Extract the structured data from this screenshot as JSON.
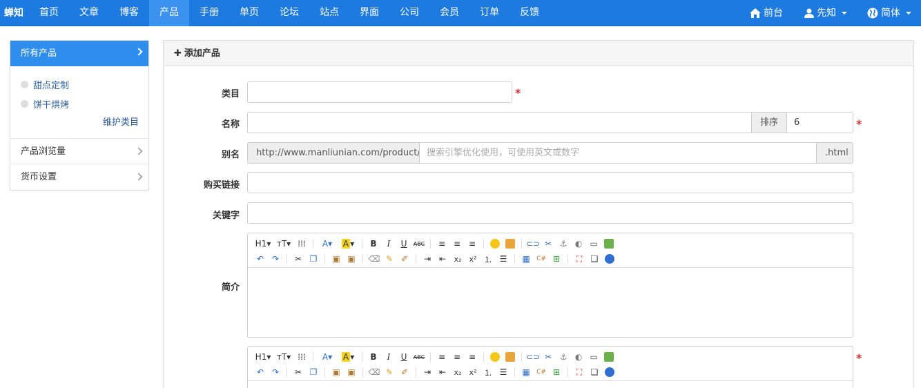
{
  "brand": "蝉知",
  "nav": {
    "items": [
      "首页",
      "文章",
      "博客",
      "产品",
      "手册",
      "单页",
      "论坛",
      "站点",
      "界面",
      "公司",
      "会员",
      "订单",
      "反馈"
    ],
    "active_index": 3,
    "frontend": "前台",
    "user": "先知",
    "lang": "简体"
  },
  "sidebar": {
    "header": "所有产品",
    "categories": [
      "甜点定制",
      "饼干烘烤"
    ],
    "maintain": "维护类目",
    "items": [
      "产品浏览量",
      "货币设置"
    ]
  },
  "form": {
    "title": "添加产品",
    "category_label": "类目",
    "name_label": "名称",
    "order_label": "排序",
    "order_value": "6",
    "alias_label": "别名",
    "alias_prefix": "http://www.manliunian.com/product/id_",
    "alias_placeholder": "搜索引擎优化使用，可使用英文或数字",
    "alias_suffix": ".html",
    "buy_link_label": "购买链接",
    "keywords_label": "关键字",
    "summary_label": "简介",
    "required_mark": "*"
  },
  "colors": {
    "navbar": "#1c7ae0",
    "active": "#3a92ee",
    "sidebar_active": "#2f8ded",
    "required": "#d9322f"
  }
}
